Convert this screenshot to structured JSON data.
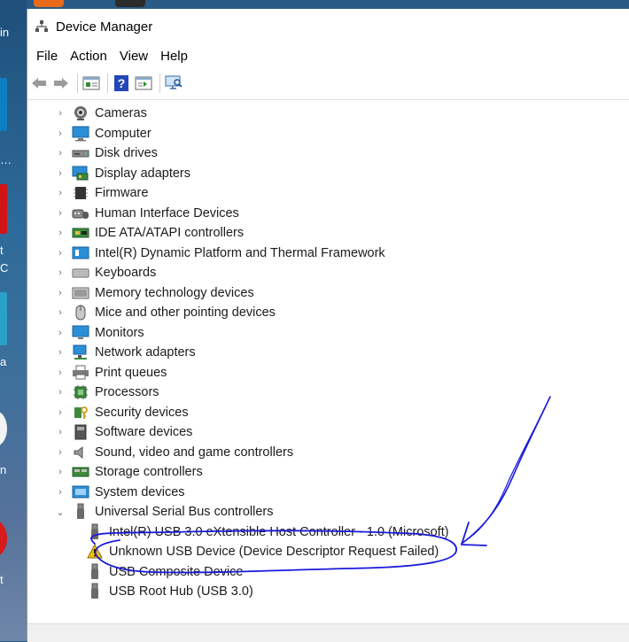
{
  "window": {
    "title": "Device Manager"
  },
  "menu": [
    "File",
    "Action",
    "View",
    "Help"
  ],
  "toolbar": {
    "buttons": [
      "back-arrow-icon",
      "forward-arrow-icon",
      "properties-icon",
      "help-icon",
      "update-driver-icon",
      "scan-hardware-icon"
    ]
  },
  "tree": {
    "categories": [
      {
        "label": "Cameras",
        "icon": "camera-icon"
      },
      {
        "label": "Computer",
        "icon": "computer-icon"
      },
      {
        "label": "Disk drives",
        "icon": "disk-drive-icon"
      },
      {
        "label": "Display adapters",
        "icon": "display-adapter-icon"
      },
      {
        "label": "Firmware",
        "icon": "firmware-icon"
      },
      {
        "label": "Human Interface Devices",
        "icon": "hid-icon"
      },
      {
        "label": "IDE ATA/ATAPI controllers",
        "icon": "ide-controller-icon"
      },
      {
        "label": "Intel(R) Dynamic Platform and Thermal Framework",
        "icon": "thermal-framework-icon"
      },
      {
        "label": "Keyboards",
        "icon": "keyboard-icon"
      },
      {
        "label": "Memory technology devices",
        "icon": "memory-device-icon"
      },
      {
        "label": "Mice and other pointing devices",
        "icon": "mouse-icon"
      },
      {
        "label": "Monitors",
        "icon": "monitor-icon"
      },
      {
        "label": "Network adapters",
        "icon": "network-adapter-icon"
      },
      {
        "label": "Print queues",
        "icon": "printer-icon"
      },
      {
        "label": "Processors",
        "icon": "processor-icon"
      },
      {
        "label": "Security devices",
        "icon": "security-device-icon"
      },
      {
        "label": "Software devices",
        "icon": "software-device-icon"
      },
      {
        "label": "Sound, video and game controllers",
        "icon": "sound-icon"
      },
      {
        "label": "Storage controllers",
        "icon": "storage-controller-icon"
      },
      {
        "label": "System devices",
        "icon": "system-device-icon"
      }
    ],
    "usb": {
      "label": "Universal Serial Bus controllers",
      "expanded": true,
      "children": [
        {
          "label": "Intel(R) USB 3.0 eXtensible Host Controller - 1.0 (Microsoft)",
          "warning": false
        },
        {
          "label": "Unknown USB Device (Device Descriptor Request Failed)",
          "warning": true
        },
        {
          "label": "USB Composite Device",
          "warning": false
        },
        {
          "label": "USB Root Hub (USB 3.0)",
          "warning": false
        }
      ]
    }
  },
  "desktop_labels": [
    "in",
    "…",
    "t",
    "C",
    "a",
    "n",
    "t"
  ],
  "colors": {
    "annotation_ink": "#1a1adc",
    "warning": "#f2c200"
  }
}
